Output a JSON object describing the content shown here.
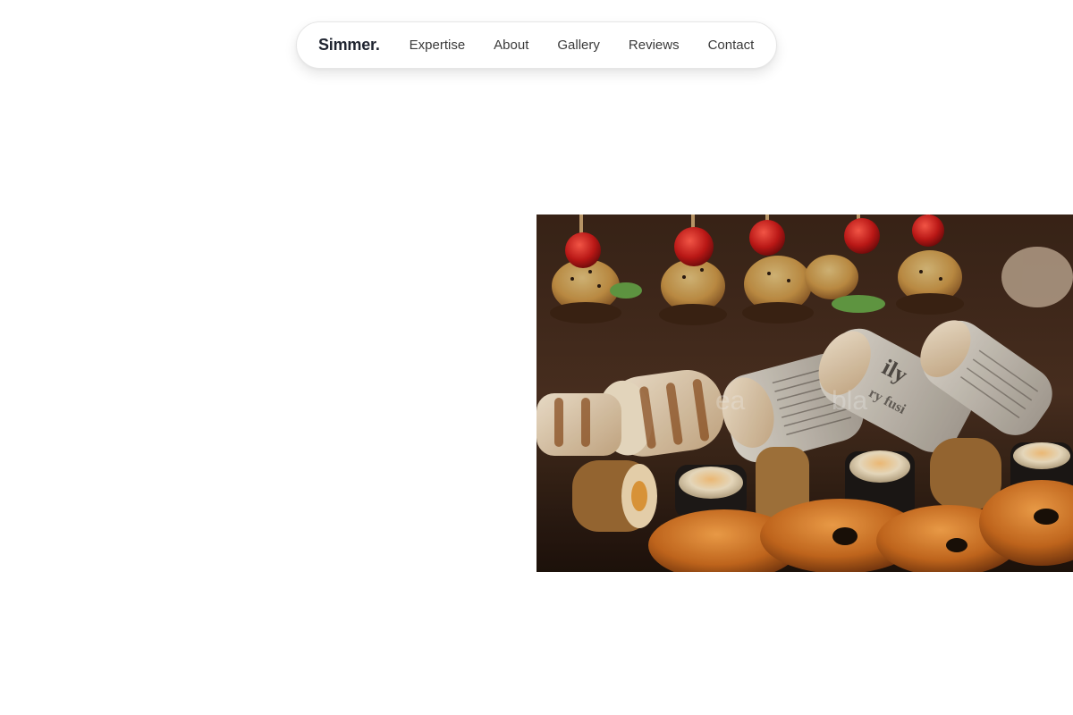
{
  "nav": {
    "brand": "Simmer.",
    "links": [
      {
        "label": "Expertise"
      },
      {
        "label": "About"
      },
      {
        "label": "Gallery"
      },
      {
        "label": "Reviews"
      },
      {
        "label": "Contact"
      }
    ]
  },
  "hero": {
    "image_subject": "food-platter-photo"
  }
}
